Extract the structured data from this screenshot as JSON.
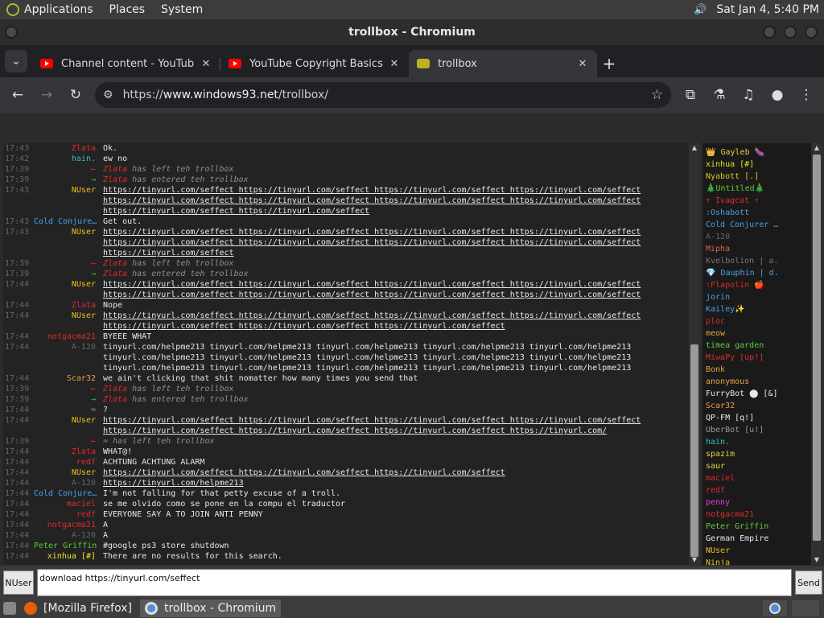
{
  "panel": {
    "menus": [
      "Applications",
      "Places",
      "System"
    ],
    "clock": "Sat Jan  4,  5:40 PM"
  },
  "window": {
    "title": "trollbox - Chromium"
  },
  "tabs": [
    {
      "label": "Channel content - YouTube Studio",
      "icon": "youtube-icon"
    },
    {
      "label": "YouTube Copyright Basics - YouTube",
      "icon": "youtube-icon"
    },
    {
      "label": "trollbox",
      "icon": "trollbox-icon"
    }
  ],
  "toolbar": {
    "url_prefix": "https://",
    "url_host": "www.windows93.net",
    "url_path": "/trollbox/"
  },
  "chat": {
    "messages": [
      {
        "time": "17:43",
        "nick": "Zlata",
        "color": "#e02a2a",
        "text": "Ok."
      },
      {
        "time": "17:42",
        "nick": "hain.",
        "color": "#3ac0c0",
        "text": "ew no"
      },
      {
        "time": "17:39",
        "nick": "←",
        "color": "#e02a2a",
        "who": "Zlata",
        "who_color": "#e02a2a",
        "text": "has left teh trollbox",
        "sys": true
      },
      {
        "time": "17:39",
        "nick": "→",
        "color": "#3cc23c",
        "who": "Zlata",
        "who_color": "#e02a2a",
        "text": "has entered teh trollbox",
        "sys": true
      },
      {
        "time": "17:43",
        "nick": "NUser",
        "color": "#e8c020",
        "text": "https://tinyurl.com/seffect https://tinyurl.com/seffect https://tinyurl.com/seffect https://tinyurl.com/seffect",
        "link": true
      },
      {
        "time": "",
        "nick": "",
        "color": "#e8c020",
        "text": "https://tinyurl.com/seffect https://tinyurl.com/seffect https://tinyurl.com/seffect https://tinyurl.com/seffect",
        "link": true
      },
      {
        "time": "",
        "nick": "",
        "color": "#e8c020",
        "text": "https://tinyurl.com/seffect https://tinyurl.com/seffect",
        "link": true
      },
      {
        "time": "17:43",
        "nick": "Cold Conjure…",
        "color": "#4aa0e6",
        "text": "Get out."
      },
      {
        "time": "17:43",
        "nick": "NUser",
        "color": "#e8c020",
        "text": "https://tinyurl.com/seffect https://tinyurl.com/seffect https://tinyurl.com/seffect https://tinyurl.com/seffect",
        "link": true
      },
      {
        "time": "",
        "nick": "",
        "color": "#e8c020",
        "text": "https://tinyurl.com/seffect https://tinyurl.com/seffect https://tinyurl.com/seffect https://tinyurl.com/seffect",
        "link": true
      },
      {
        "time": "",
        "nick": "",
        "color": "#e8c020",
        "text": "https://tinyurl.com/seffect",
        "link": true
      },
      {
        "time": "17:39",
        "nick": "←",
        "color": "#e02a2a",
        "who": "Zlata",
        "who_color": "#e02a2a",
        "text": "has left teh trollbox",
        "sys": true
      },
      {
        "time": "17:39",
        "nick": "→",
        "color": "#3cc23c",
        "who": "Zlata",
        "who_color": "#e02a2a",
        "text": "has entered teh trollbox",
        "sys": true
      },
      {
        "time": "17:44",
        "nick": "NUser",
        "color": "#e8c020",
        "text": "https://tinyurl.com/seffect https://tinyurl.com/seffect https://tinyurl.com/seffect https://tinyurl.com/seffect",
        "link": true
      },
      {
        "time": "",
        "nick": "",
        "color": "#e8c020",
        "text": "https://tinyurl.com/seffect https://tinyurl.com/seffect https://tinyurl.com/seffect https://tinyurl.com/seffect",
        "link": true
      },
      {
        "time": "17:44",
        "nick": "Zlata",
        "color": "#e02a2a",
        "text": "Nope"
      },
      {
        "time": "17:44",
        "nick": "NUser",
        "color": "#e8c020",
        "text": "https://tinyurl.com/seffect https://tinyurl.com/seffect https://tinyurl.com/seffect https://tinyurl.com/seffect",
        "link": true
      },
      {
        "time": "",
        "nick": "",
        "color": "#e8c020",
        "text": "https://tinyurl.com/seffect https://tinyurl.com/seffect https://tinyurl.com/seffect",
        "link": true
      },
      {
        "time": "17:44",
        "nick": "notgacma21",
        "color": "#e02a2a",
        "text": "BYEEE WHAT"
      },
      {
        "time": "17:44",
        "nick": "A-120",
        "color": "#666666",
        "text": "tinyurl.com/helpme213 tinyurl.com/helpme213 tinyurl.com/helpme213 tinyurl.com/helpme213 tinyurl.com/helpme213"
      },
      {
        "time": "",
        "nick": "",
        "color": "#666666",
        "text": "tinyurl.com/helpme213 tinyurl.com/helpme213 tinyurl.com/helpme213 tinyurl.com/helpme213 tinyurl.com/helpme213"
      },
      {
        "time": "",
        "nick": "",
        "color": "#666666",
        "text": "tinyurl.com/helpme213 tinyurl.com/helpme213 tinyurl.com/helpme213 tinyurl.com/helpme213 tinyurl.com/helpme213"
      },
      {
        "time": "17:44",
        "nick": "Scar32",
        "color": "#e8a040",
        "text": "we ain't clicking that shit nomatter how many times you send that"
      },
      {
        "time": "17:39",
        "nick": "←",
        "color": "#e02a2a",
        "who": "Zlata",
        "who_color": "#e02a2a",
        "text": "has left teh trollbox",
        "sys": true
      },
      {
        "time": "17:39",
        "nick": "→",
        "color": "#3cc23c",
        "who": "Zlata",
        "who_color": "#e02a2a",
        "text": "has entered teh trollbox",
        "sys": true
      },
      {
        "time": "17:44",
        "nick": "≈",
        "color": "#888888",
        "text": "?"
      },
      {
        "time": "17:44",
        "nick": "NUser",
        "color": "#e8c020",
        "text": "https://tinyurl.com/seffect https://tinyurl.com/seffect https://tinyurl.com/seffect https://tinyurl.com/seffect",
        "link": true
      },
      {
        "time": "",
        "nick": "",
        "color": "#e8c020",
        "text": "https://tinyurl.com/seffect https://tinyurl.com/seffect https://tinyurl.com/seffect https://tinyurl.com/",
        "link": true
      },
      {
        "time": "17:39",
        "nick": "←",
        "color": "#e02a2a",
        "who": "≈",
        "who_color": "#888888",
        "text": "has left teh trollbox",
        "sys": true
      },
      {
        "time": "17:44",
        "nick": "Zlata",
        "color": "#e02a2a",
        "text": "WHAT@!"
      },
      {
        "time": "17:44",
        "nick": "redf",
        "color": "#e02a2a",
        "text": "ACHTUNG ACHTUNG ALARM"
      },
      {
        "time": "17:44",
        "nick": "NUser",
        "color": "#e8c020",
        "text": "https://tinyurl.com/seffect https://tinyurl.com/seffect https://tinyurl.com/seffect",
        "link": true
      },
      {
        "time": "17:44",
        "nick": "A-120",
        "color": "#666666",
        "text": "https://tinyurl.com/helpme213",
        "link": true
      },
      {
        "time": "17:44",
        "nick": "Cold Conjure…",
        "color": "#4aa0e6",
        "text": "I'm not falling for that petty excuse of a troll."
      },
      {
        "time": "17:44",
        "nick": "maciel",
        "color": "#e02a2a",
        "text": "se me olvido como se pone en la compu el traductor"
      },
      {
        "time": "17:44",
        "nick": "redf",
        "color": "#e02a2a",
        "text": "EVERYONE SAY A TO JOIN ANTI PENNY"
      },
      {
        "time": "17:44",
        "nick": "notgacma21",
        "color": "#e02a2a",
        "text": "A"
      },
      {
        "time": "17:44",
        "nick": "A-120",
        "color": "#666666",
        "text": "A"
      },
      {
        "time": "17:44",
        "nick": "Peter Griffin",
        "color": "#5ccc3c",
        "text": "#google ps3 store shutdown"
      },
      {
        "time": "17:44",
        "nick": "xinhua [#]",
        "color": "#e8e020",
        "text": "There are no results for this search."
      }
    ]
  },
  "users": [
    {
      "name": "👑 Gayleb 🍆",
      "color": "#e8d040"
    },
    {
      "name": "xinhua [#]",
      "color": "#e8e020"
    },
    {
      "name": "Nyabott [.]",
      "color": "#e8c020"
    },
    {
      "name": "🎄Untitled🎄",
      "color": "#5ccc3c"
    },
    {
      "name": "↑ Ivagcat ↑",
      "color": "#e02a2a"
    },
    {
      "name": ":Oshabott",
      "color": "#4aa0e6"
    },
    {
      "name": "Cold Conjurer …",
      "color": "#4aa0e6"
    },
    {
      "name": "A-120",
      "color": "#666666"
    },
    {
      "name": "Mipha",
      "color": "#e06050"
    },
    {
      "name": "Kvelbolion | a.",
      "color": "#777777"
    },
    {
      "name": "💎 Dauphin | d.",
      "color": "#4aa0e6"
    },
    {
      "name": ":Flapolin 🍎",
      "color": "#e02a2a"
    },
    {
      "name": "jorin",
      "color": "#4aa0e6"
    },
    {
      "name": "Kailey✨",
      "color": "#4aa0e6"
    },
    {
      "name": "ploc",
      "color": "#e02a2a"
    },
    {
      "name": "meow",
      "color": "#e8a040"
    },
    {
      "name": "timea garden",
      "color": "#5ccc3c"
    },
    {
      "name": "MiwaPy [up!]",
      "color": "#e02a2a"
    },
    {
      "name": "Bonk",
      "color": "#e8a040"
    },
    {
      "name": "anonymous",
      "color": "#e8a040"
    },
    {
      "name": "FurryBot ⬤ [&]",
      "color": "#e8e8e8"
    },
    {
      "name": "Scar32",
      "color": "#e8a040"
    },
    {
      "name": "QP-FM [q!]",
      "color": "#e8e8e8"
    },
    {
      "name": "UberBot [u!]",
      "color": "#999999"
    },
    {
      "name": "hain.",
      "color": "#3ac0c0"
    },
    {
      "name": "spazim",
      "color": "#e8d040"
    },
    {
      "name": "saur",
      "color": "#e8d040"
    },
    {
      "name": "maciel",
      "color": "#e02a2a"
    },
    {
      "name": "redf",
      "color": "#e02a2a"
    },
    {
      "name": "penny",
      "color": "#e040e0"
    },
    {
      "name": "notgacma21",
      "color": "#e02a2a"
    },
    {
      "name": "Peter Griffin",
      "color": "#5ccc3c"
    },
    {
      "name": "German Empire",
      "color": "#e8e8e8"
    },
    {
      "name": "NUser",
      "color": "#e8c020"
    },
    {
      "name": "Ninja",
      "color": "#e8c020"
    }
  ],
  "input": {
    "nick": "NUser",
    "value": "download https://tinyurl.com/seffect",
    "send_label": "Send"
  },
  "taskbar": {
    "tasks": [
      {
        "label": "[Mozilla Firefox]",
        "icon": "firefox-icon"
      },
      {
        "label": "trollbox - Chromium",
        "icon": "chromium-icon"
      }
    ]
  }
}
